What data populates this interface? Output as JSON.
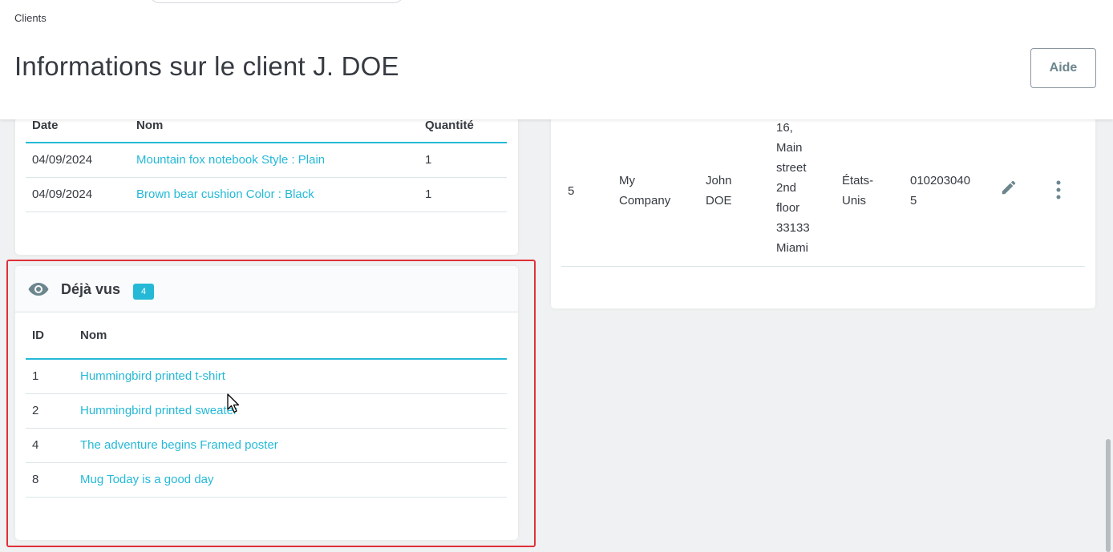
{
  "header": {
    "breadcrumb": "Clients",
    "title": "Informations sur le client J. DOE",
    "help_label": "Aide"
  },
  "orders": {
    "columns": [
      "Date",
      "Nom",
      "Quantité"
    ],
    "rows": [
      {
        "date": "04/09/2024",
        "name": "Mountain fox notebook Style : Plain",
        "qty": "1"
      },
      {
        "date": "04/09/2024",
        "name": "Brown bear cushion Color : Black",
        "qty": "1"
      }
    ]
  },
  "viewed": {
    "icon": "eye-icon",
    "title": "Déjà vus",
    "count": "4",
    "columns": [
      "ID",
      "Nom"
    ],
    "rows": [
      {
        "id": "1",
        "name": "Hummingbird printed t-shirt"
      },
      {
        "id": "2",
        "name": "Hummingbird printed sweater"
      },
      {
        "id": "4",
        "name": "The adventure begins Framed poster"
      },
      {
        "id": "8",
        "name": "Mug Today is a good day"
      }
    ]
  },
  "address": {
    "id": "5",
    "company_lines": [
      "My",
      "Company"
    ],
    "name_lines": [
      "John",
      "DOE"
    ],
    "address_lines": [
      "16,",
      "Main",
      "street",
      "2nd",
      "floor",
      "33133",
      "Miami"
    ],
    "country_lines": [
      "États-",
      "Unis"
    ],
    "phone_lines": [
      "010203040",
      "5"
    ]
  },
  "colors": {
    "accent": "#25b9d7",
    "highlight": "#e0303a",
    "text": "#363a41"
  }
}
